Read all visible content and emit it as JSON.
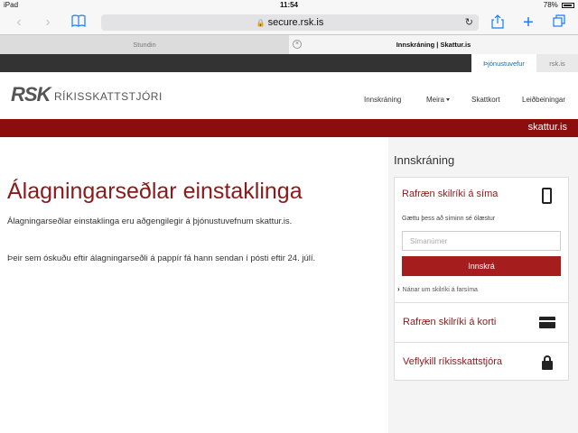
{
  "statusbar": {
    "device": "iPad",
    "time": "11:54",
    "battery": "78%"
  },
  "browser": {
    "url": "secure.rsk.is",
    "tabs": [
      {
        "label": "Stundin"
      },
      {
        "label": "Innskráning | Skattur.is"
      }
    ]
  },
  "topstrip": {
    "link1": "Þjónustuvefur",
    "link2": "rsk.is"
  },
  "header": {
    "logo": "RSK",
    "logo_text": "RÍKISSKATTSTJÓRI",
    "nav": [
      "Innskráning",
      "Meira",
      "Skattkort",
      "Leiðbeiningar"
    ]
  },
  "redbar": {
    "site": "skattur.is"
  },
  "main": {
    "title": "Álagningarseðlar einstaklinga",
    "para1": "Álagningarseðlar einstaklinga eru aðgengilegir á þjónustuvefnum skattur.is.",
    "para2": "Þeir sem óskuðu eftir álagningarseðli á pappír fá hann sendan í pósti eftir 24. júlí."
  },
  "login": {
    "title": "Innskráning",
    "phone_option": "Rafræn skilríki á síma",
    "hint": "Gættu þess að síminn sé ólæstur",
    "phone_placeholder": "Símanúmer",
    "submit": "Innskrá",
    "more": "Nánar um skilríki á farsíma",
    "card_option": "Rafræn skilríki á korti",
    "key_option": "Veflykill ríkisskattstjóra"
  }
}
